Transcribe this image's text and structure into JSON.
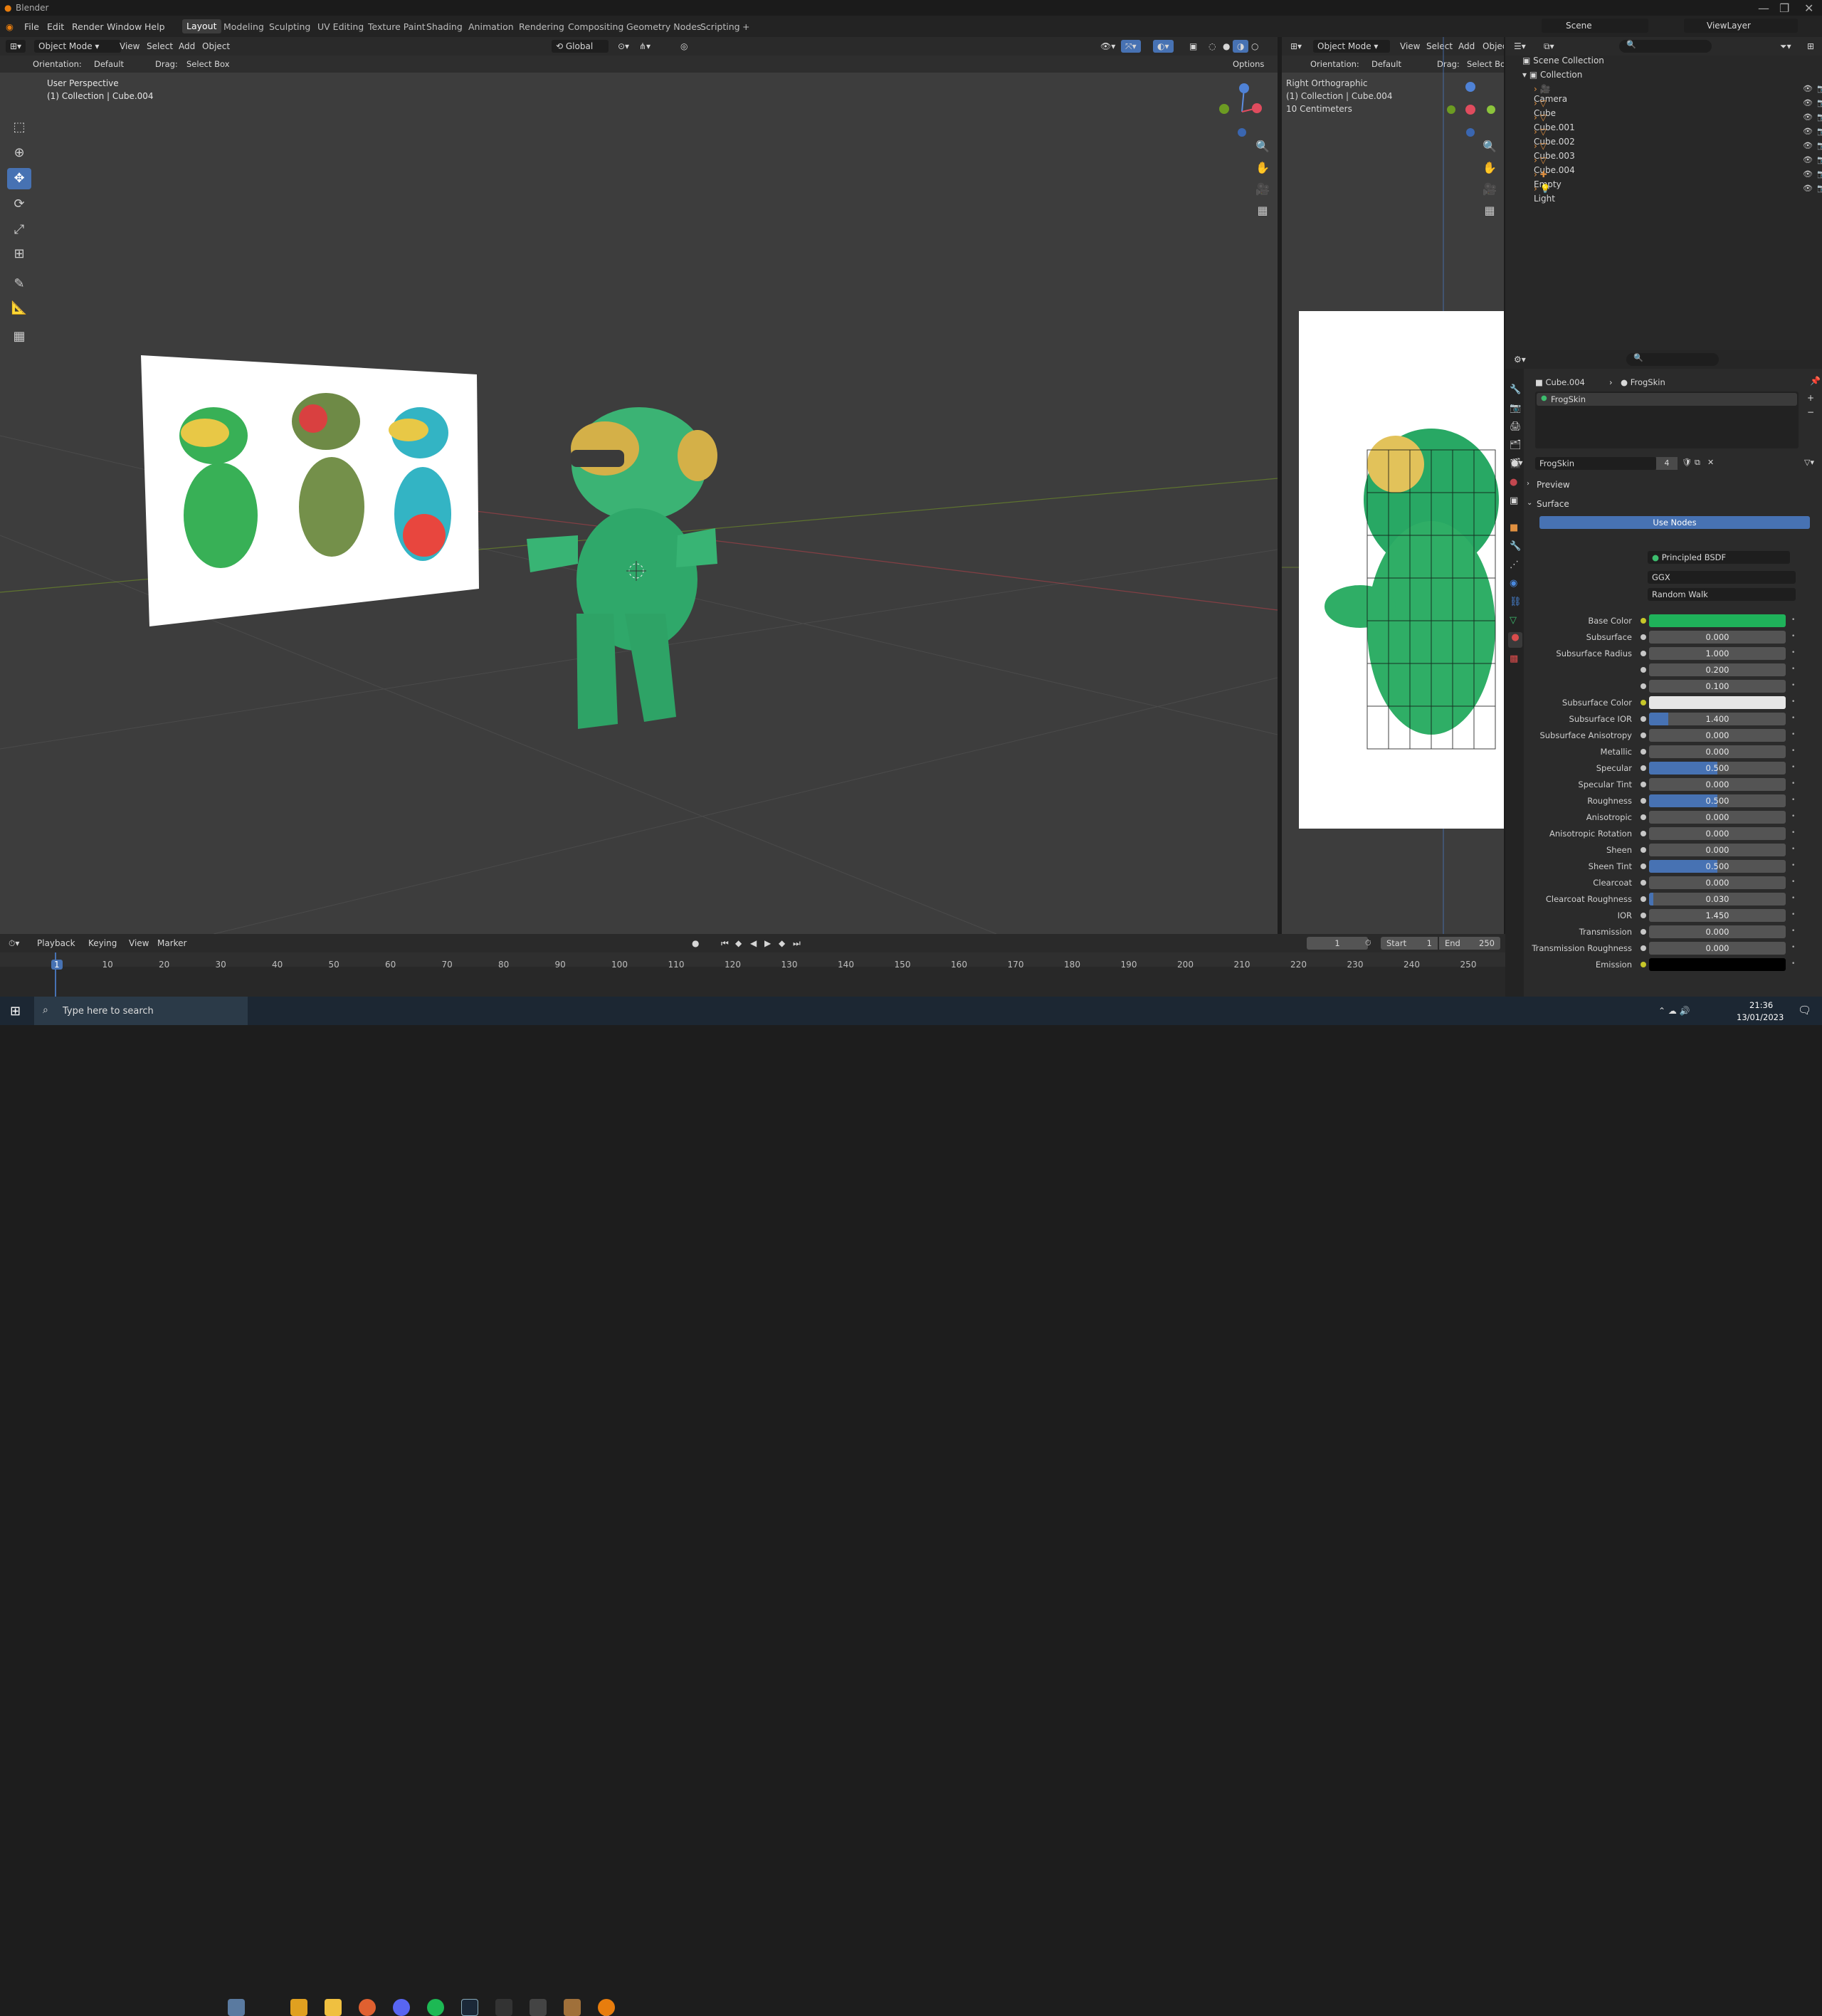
{
  "window": {
    "title": "Blender"
  },
  "menu": {
    "file": "File",
    "edit": "Edit",
    "render": "Render",
    "window": "Window",
    "help": "Help"
  },
  "workspaces": [
    "Layout",
    "Modeling",
    "Sculpting",
    "UV Editing",
    "Texture Paint",
    "Shading",
    "Animation",
    "Rendering",
    "Compositing",
    "Geometry Nodes",
    "Scripting"
  ],
  "scene": {
    "name": "Scene",
    "view_layer": "ViewLayer"
  },
  "viewport_left": {
    "mode": "Object Mode",
    "view": "View",
    "select": "Select",
    "add": "Add",
    "object": "Object",
    "transform": "Global",
    "orientation_label": "Orientation:",
    "orientation": "Default",
    "drag_label": "Drag:",
    "drag": "Select Box",
    "options": "Options",
    "overlay_line1": "User Perspective",
    "overlay_line2": "(1) Collection | Cube.004"
  },
  "viewport_right": {
    "mode": "Object Mode",
    "view": "View",
    "select": "Select",
    "add": "Add",
    "object": "Objec",
    "orientation_label": "Orientation:",
    "orientation": "Default",
    "drag_label": "Drag:",
    "drag": "Select Box",
    "overlay_line1": "Right Orthographic",
    "overlay_line2": "(1) Collection | Cube.004",
    "overlay_line3": "10 Centimeters"
  },
  "outliner": {
    "root": "Scene Collection",
    "collection": "Collection",
    "items": [
      {
        "name": "Camera",
        "color": "#e09040"
      },
      {
        "name": "Cube",
        "color": "#e09040"
      },
      {
        "name": "Cube.001",
        "color": "#e09040"
      },
      {
        "name": "Cube.002",
        "color": "#e09040"
      },
      {
        "name": "Cube.003",
        "color": "#e09040"
      },
      {
        "name": "Cube.004",
        "color": "#e09040"
      },
      {
        "name": "Empty",
        "color": "#e09040"
      },
      {
        "name": "Light",
        "color": "#e09040"
      }
    ]
  },
  "properties": {
    "breadcrumb_object": "Cube.004",
    "breadcrumb_material": "FrogSkin",
    "slot_name": "FrogSkin",
    "material_name": "FrogSkin",
    "user_count": "4",
    "preview": "Preview",
    "surface_panel": "Surface",
    "use_nodes": "Use Nodes",
    "surface_label": "Surface",
    "surface_shader": "Principled BSDF",
    "distribution": "GGX",
    "subsurface_method": "Random Walk",
    "rows": [
      {
        "label": "Base Color",
        "kind": "color",
        "color": "#1fb25a"
      },
      {
        "label": "Subsurface",
        "value": "0.000",
        "fill": 0
      },
      {
        "label": "Subsurface Radius",
        "value": "1.000",
        "fill": 0
      },
      {
        "label": "",
        "value": "0.200",
        "fill": 0
      },
      {
        "label": "",
        "value": "0.100",
        "fill": 0
      },
      {
        "label": "Subsurface Color",
        "kind": "color",
        "color": "#e6e6e6"
      },
      {
        "label": "Subsurface IOR",
        "value": "1.400",
        "fill": 0.14
      },
      {
        "label": "Subsurface Anisotropy",
        "value": "0.000",
        "fill": 0
      },
      {
        "label": "Metallic",
        "value": "0.000",
        "fill": 0
      },
      {
        "label": "Specular",
        "value": "0.500",
        "fill": 0.5
      },
      {
        "label": "Specular Tint",
        "value": "0.000",
        "fill": 0
      },
      {
        "label": "Roughness",
        "value": "0.500",
        "fill": 0.5
      },
      {
        "label": "Anisotropic",
        "value": "0.000",
        "fill": 0
      },
      {
        "label": "Anisotropic Rotation",
        "value": "0.000",
        "fill": 0
      },
      {
        "label": "Sheen",
        "value": "0.000",
        "fill": 0
      },
      {
        "label": "Sheen Tint",
        "value": "0.500",
        "fill": 0.5
      },
      {
        "label": "Clearcoat",
        "value": "0.000",
        "fill": 0
      },
      {
        "label": "Clearcoat Roughness",
        "value": "0.030",
        "fill": 0.03
      },
      {
        "label": "IOR",
        "value": "1.450",
        "fill": 0
      },
      {
        "label": "Transmission",
        "value": "0.000",
        "fill": 0
      },
      {
        "label": "Transmission Roughness",
        "value": "0.000",
        "fill": 0
      },
      {
        "label": "Emission",
        "kind": "color",
        "color": "#000000"
      }
    ]
  },
  "timeline": {
    "playback": "Playback",
    "keying": "Keying",
    "view": "View",
    "marker": "Marker",
    "current_frame": "1",
    "start_label": "Start",
    "start": "1",
    "end_label": "End",
    "end": "250",
    "ticks": [
      "1",
      "10",
      "20",
      "30",
      "40",
      "50",
      "60",
      "70",
      "80",
      "90",
      "100",
      "110",
      "120",
      "130",
      "140",
      "150",
      "160",
      "170",
      "180",
      "190",
      "200",
      "210",
      "220",
      "230",
      "240",
      "250"
    ]
  },
  "taskbar": {
    "search_placeholder": "Type here to search",
    "time": "21:36",
    "date": "13/01/2023"
  }
}
